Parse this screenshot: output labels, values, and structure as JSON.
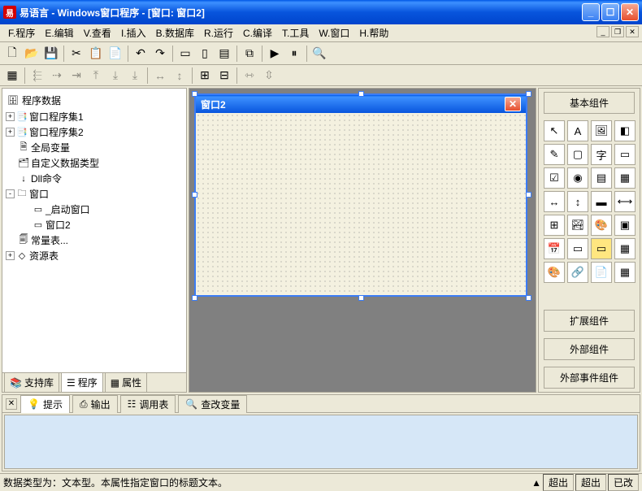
{
  "title": "易语言 - Windows窗口程序 - [窗口: 窗口2]",
  "menu": [
    "F.程序",
    "E.编辑",
    "V.查看",
    "I.插入",
    "B.数据库",
    "R.运行",
    "C.编译",
    "T.工具",
    "W.窗口",
    "H.帮助"
  ],
  "tree": {
    "root": "程序数据",
    "items": [
      {
        "indent": 0,
        "exp": "+",
        "icon": "📑",
        "label": "窗口程序集1"
      },
      {
        "indent": 0,
        "exp": "+",
        "icon": "📑",
        "label": "窗口程序集2"
      },
      {
        "indent": 0,
        "exp": "",
        "icon": "🗎",
        "label": "全局变量"
      },
      {
        "indent": 0,
        "exp": "",
        "icon": "🗂",
        "label": "自定义数据类型"
      },
      {
        "indent": 0,
        "exp": "",
        "icon": "↓",
        "label": "Dll命令"
      },
      {
        "indent": 0,
        "exp": "-",
        "icon": "🗀",
        "label": "窗口"
      },
      {
        "indent": 1,
        "exp": "",
        "icon": "▭",
        "label": "_启动窗口"
      },
      {
        "indent": 1,
        "exp": "",
        "icon": "▭",
        "label": "窗口2"
      },
      {
        "indent": 0,
        "exp": "",
        "icon": "🗐",
        "label": "常量表..."
      },
      {
        "indent": 0,
        "exp": "+",
        "icon": "◇",
        "label": "资源表"
      }
    ]
  },
  "left_tabs": [
    "支持库",
    "程序",
    "属性"
  ],
  "design_window_title": "窗口2",
  "right_panel": {
    "header": "基本组件",
    "footer": [
      "扩展组件",
      "外部组件",
      "外部事件组件"
    ]
  },
  "bottom_tabs": [
    "提示",
    "输出",
    "调用表",
    "查改变量"
  ],
  "status": "数据类型为：文本型。本属性指定窗口的标题文本。",
  "status_right": {
    "a": "超出",
    "b": "超出",
    "c": "已改"
  }
}
